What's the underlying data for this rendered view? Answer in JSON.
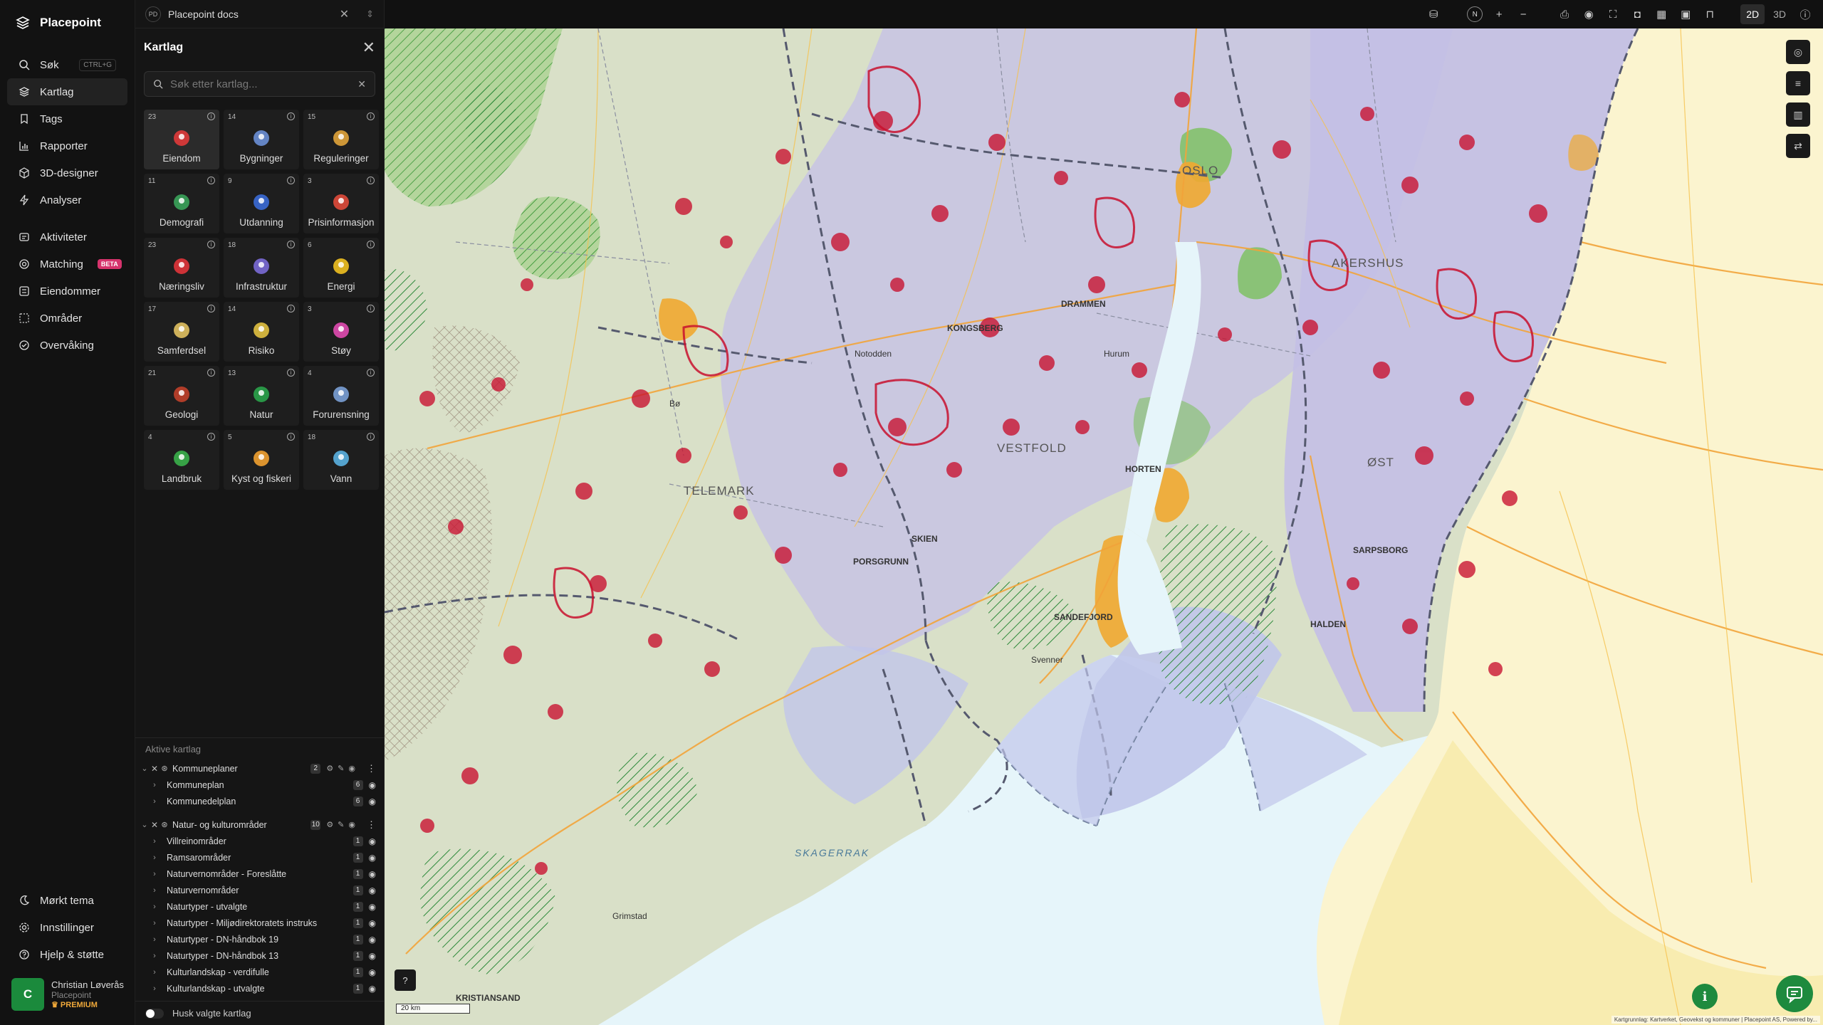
{
  "brand": {
    "name": "Placepoint"
  },
  "nav": {
    "items": [
      {
        "label": "Søk",
        "icon": "search-icon",
        "shortcut": "CTRL+G"
      },
      {
        "label": "Kartlag",
        "icon": "layers-icon"
      },
      {
        "label": "Tags",
        "icon": "bookmark-icon"
      },
      {
        "label": "Rapporter",
        "icon": "chart-icon"
      },
      {
        "label": "3D-designer",
        "icon": "cube-icon"
      },
      {
        "label": "Analyser",
        "icon": "bolt-icon"
      },
      {
        "label": "Aktiviteter",
        "icon": "activity-icon"
      },
      {
        "label": "Matching",
        "icon": "target-icon",
        "badge": "BETA"
      },
      {
        "label": "Eiendommer",
        "icon": "list-icon"
      },
      {
        "label": "Områder",
        "icon": "area-icon"
      },
      {
        "label": "Overvåking",
        "icon": "check-circle-icon"
      }
    ],
    "bottom": [
      {
        "label": "Mørkt tema",
        "icon": "moon-icon"
      },
      {
        "label": "Innstillinger",
        "icon": "gear-icon"
      },
      {
        "label": "Hjelp & støtte",
        "icon": "help-icon"
      }
    ],
    "user": {
      "initial": "C",
      "name": "Christian Løverås",
      "org": "Placepoint",
      "plan": "PREMIUM"
    }
  },
  "doc_tab": {
    "badge": "PD",
    "title": "Placepoint docs"
  },
  "panel": {
    "title": "Kartlag",
    "search_placeholder": "Søk etter kartlag...",
    "categories": [
      {
        "count": "23",
        "label": "Eiendom",
        "icon": "pin-icon",
        "color": "#e03a3a"
      },
      {
        "count": "14",
        "label": "Bygninger",
        "icon": "building-icon",
        "color": "#6a8fd6"
      },
      {
        "count": "15",
        "label": "Reguleringer",
        "icon": "signpost-icon",
        "color": "#e0a33a"
      },
      {
        "count": "11",
        "label": "Demografi",
        "icon": "age-icon",
        "color": "#3aa35a"
      },
      {
        "count": "9",
        "label": "Utdanning",
        "icon": "graduation-icon",
        "color": "#3a6ad6"
      },
      {
        "count": "3",
        "label": "Prisinformasjon",
        "icon": "shopping-bag-icon",
        "color": "#e04a3a"
      },
      {
        "count": "23",
        "label": "Næringsliv",
        "icon": "briefcase-icon",
        "color": "#e0343a"
      },
      {
        "count": "18",
        "label": "Infrastruktur",
        "icon": "globe-icon",
        "color": "#7a6ad6"
      },
      {
        "count": "6",
        "label": "Energi",
        "icon": "lightning-icon",
        "color": "#f0c020"
      },
      {
        "count": "17",
        "label": "Samferdsel",
        "icon": "bus-icon",
        "color": "#e0c060"
      },
      {
        "count": "14",
        "label": "Risiko",
        "icon": "hazard-icon",
        "color": "#e0c040"
      },
      {
        "count": "3",
        "label": "Støy",
        "icon": "noise-icon",
        "color": "#e04ab0"
      },
      {
        "count": "21",
        "label": "Geologi",
        "icon": "terrain-icon",
        "color": "#c0402a"
      },
      {
        "count": "13",
        "label": "Natur",
        "icon": "leaf-icon",
        "color": "#2aa34a"
      },
      {
        "count": "4",
        "label": "Forurensning",
        "icon": "factory-icon",
        "color": "#7aa0d6"
      },
      {
        "count": "4",
        "label": "Landbruk",
        "icon": "sprout-icon",
        "color": "#3ab04a"
      },
      {
        "count": "5",
        "label": "Kyst og fiskeri",
        "icon": "fish-icon",
        "color": "#f0a030"
      },
      {
        "count": "18",
        "label": "Vann",
        "icon": "drop-icon",
        "color": "#5ab0e0"
      }
    ],
    "active_title": "Aktive kartlag",
    "groups": [
      {
        "name": "Kommuneplaner",
        "count": "2",
        "layers": [
          {
            "name": "Kommuneplan",
            "count": "6"
          },
          {
            "name": "Kommunedelplan",
            "count": "6"
          }
        ]
      },
      {
        "name": "Natur- og kulturområder",
        "count": "10",
        "layers": [
          {
            "name": "Villreinområder",
            "count": "1"
          },
          {
            "name": "Ramsarområder",
            "count": "1"
          },
          {
            "name": "Naturvernområder - Foreslåtte",
            "count": "1"
          },
          {
            "name": "Naturvernområder",
            "count": "1"
          },
          {
            "name": "Naturtyper - utvalgte",
            "count": "1"
          },
          {
            "name": "Naturtyper - Miljødirektoratets instruks",
            "count": "1"
          },
          {
            "name": "Naturtyper - DN-håndbok 19",
            "count": "1"
          },
          {
            "name": "Naturtyper - DN-håndbok 13",
            "count": "1"
          },
          {
            "name": "Kulturlandskap - verdifulle",
            "count": "1"
          },
          {
            "name": "Kulturlandskap - utvalgte",
            "count": "1"
          }
        ]
      }
    ],
    "remember_label": "Husk valgte kartlag"
  },
  "toolbar": {
    "compass": "N",
    "view_2d": "2D",
    "view_3d": "3D"
  },
  "map": {
    "labels": {
      "oslo": "OSLO",
      "akershus": "AKERSHUS",
      "vestfold": "VESTFOLD",
      "telemark": "TELEMARK",
      "ostfold": "ØST",
      "skagerrak": "SKAGERRAK",
      "kongsberg": "KONGSBERG",
      "drammen": "DRAMMEN",
      "porsgrunn": "PORSGRUNN",
      "sandefjord": "SANDEFJORD",
      "sarpsborg": "SARPSBORG",
      "halden": "HALDEN",
      "horten": "HORTEN",
      "svenner": "Svenner",
      "grimstad": "Grimstad",
      "kristiansand": "KRISTIANSAND",
      "hurum": "Hurum",
      "notodden": "Notodden",
      "bo": "Bø",
      "skien": "SKIEN"
    },
    "scale": "20 km",
    "attribution": "Kartgrunnlag: Kartverket, Geovekst og kommuner | Placepoint AS, Powered by..."
  }
}
